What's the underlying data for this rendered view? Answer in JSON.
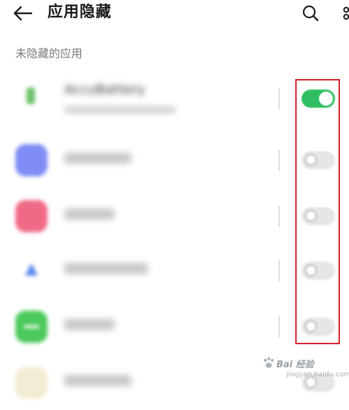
{
  "header": {
    "title": "应用隐藏",
    "back_icon": "arrow-left-icon",
    "search_icon": "search-icon",
    "more_icon": "more-icon"
  },
  "section": {
    "label": "未隐藏的应用"
  },
  "apps": [
    {
      "name": "AccuBattery",
      "toggle_on": true,
      "icon_color": "#6cc06a"
    },
    {
      "name": "",
      "toggle_on": false,
      "icon_color": "#7e8cf4"
    },
    {
      "name": "",
      "toggle_on": false,
      "icon_color": "#f06a86"
    },
    {
      "name": "",
      "toggle_on": false,
      "icon_color": "#5b86ee"
    },
    {
      "name": "",
      "toggle_on": false,
      "icon_color": "#4cc95c"
    },
    {
      "name": "",
      "toggle_on": false,
      "icon_color": "#e6d9a6"
    }
  ],
  "colors": {
    "toggle_on": "#2fbf62",
    "toggle_off": "#e6e6e6",
    "highlight_box": "#d6202a"
  },
  "watermark": {
    "text": "Bai 经验",
    "sub": "jingyan.baidu.com"
  }
}
